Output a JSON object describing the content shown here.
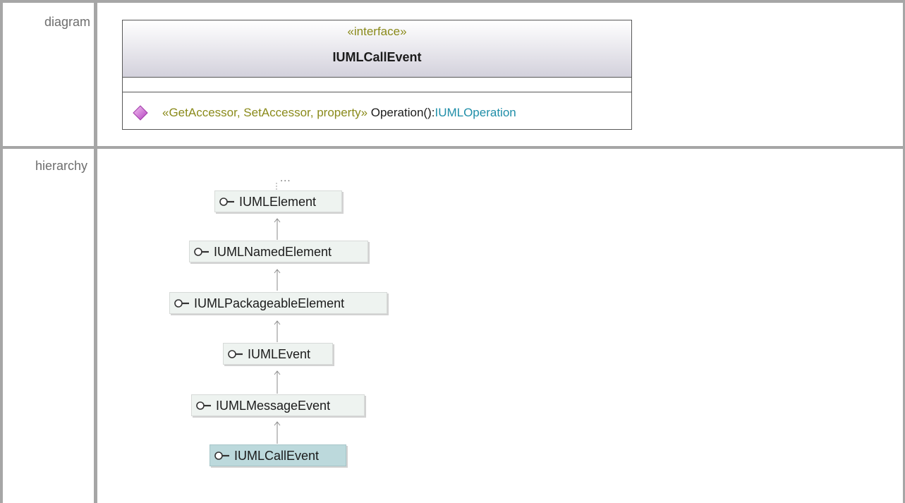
{
  "rows": {
    "diagram_label": "diagram",
    "hierarchy_label": "hierarchy"
  },
  "interface": {
    "stereotype": "«interface»",
    "name": "IUMLCallEvent",
    "operation": {
      "icon": "operation-diamond-icon",
      "stereotypes": "«GetAccessor, SetAccessor, property»",
      "name": " Operation():",
      "type": "IUMLOperation"
    }
  },
  "hierarchy": {
    "ellipsis": "...",
    "nodes": [
      {
        "label": "IUMLElement",
        "icon": "interface-lollipop-icon"
      },
      {
        "label": "IUMLNamedElement",
        "icon": "interface-lollipop-icon"
      },
      {
        "label": "IUMLPackageableElement",
        "icon": "interface-lollipop-icon"
      },
      {
        "label": "IUMLEvent",
        "icon": "interface-lollipop-icon"
      },
      {
        "label": "IUMLMessageEvent",
        "icon": "interface-lollipop-icon"
      },
      {
        "label": "IUMLCallEvent",
        "icon": "interface-lollipop-icon",
        "selected": true
      }
    ]
  },
  "colors": {
    "stereotype": "#8a8a1a",
    "type": "#1f8ea8",
    "selected_node": "#bcd9dc",
    "node": "#eef3f0"
  }
}
